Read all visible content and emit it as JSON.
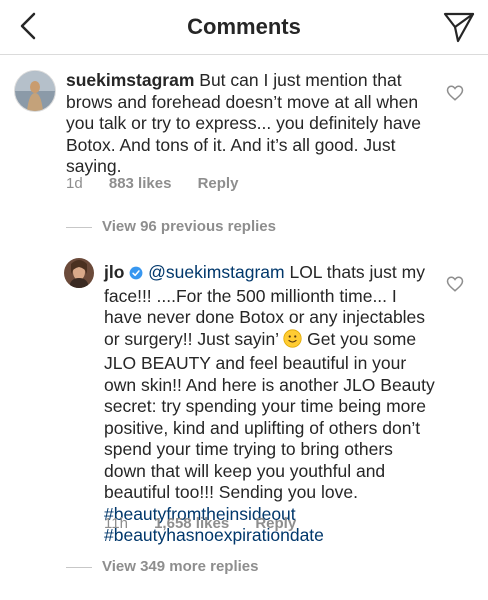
{
  "header": {
    "title": "Comments"
  },
  "comments": [
    {
      "username": "suekimstagram",
      "text": "But can I just mention that brows and forehead doesn’t move at all when you talk or try to express... you definitely have Botox. And tons of it. And it’s all good.  Just saying.",
      "time": "1d",
      "likes": "883 likes",
      "reply": "Reply"
    },
    {
      "view_replies": "View 96 previous replies"
    },
    {
      "username": "jlo",
      "verified": true,
      "mention": "@suekimstagram",
      "text_before_emoji": " LOL thats just my face!!! ....For the 500 millionth time... I have never done Botox or any injectables or surgery!! Just sayin’ ",
      "emoji": "slightly-smiling-face",
      "text_after_emoji": " Get you some JLO BEAUTY and feel beautiful in your own skin!! And here is  another JLO Beauty secret: try spending your time being more positive, kind and uplifting of others don’t spend your time trying to bring others down that will keep you youthful and beautiful too!!! Sending you love. ",
      "hashtag1": "#beautyfromtheinsideout",
      "hashtag2": "#beautyhasnoexpirationdate",
      "time": "11h",
      "likes": "1,658 likes",
      "reply": "Reply"
    },
    {
      "view_replies": "View 349 more replies"
    }
  ],
  "colors": {
    "text": "#262626",
    "secondary": "#8e8e8e",
    "link": "#00376b",
    "verified": "#3897f0",
    "emoji": "#ffcc33"
  }
}
